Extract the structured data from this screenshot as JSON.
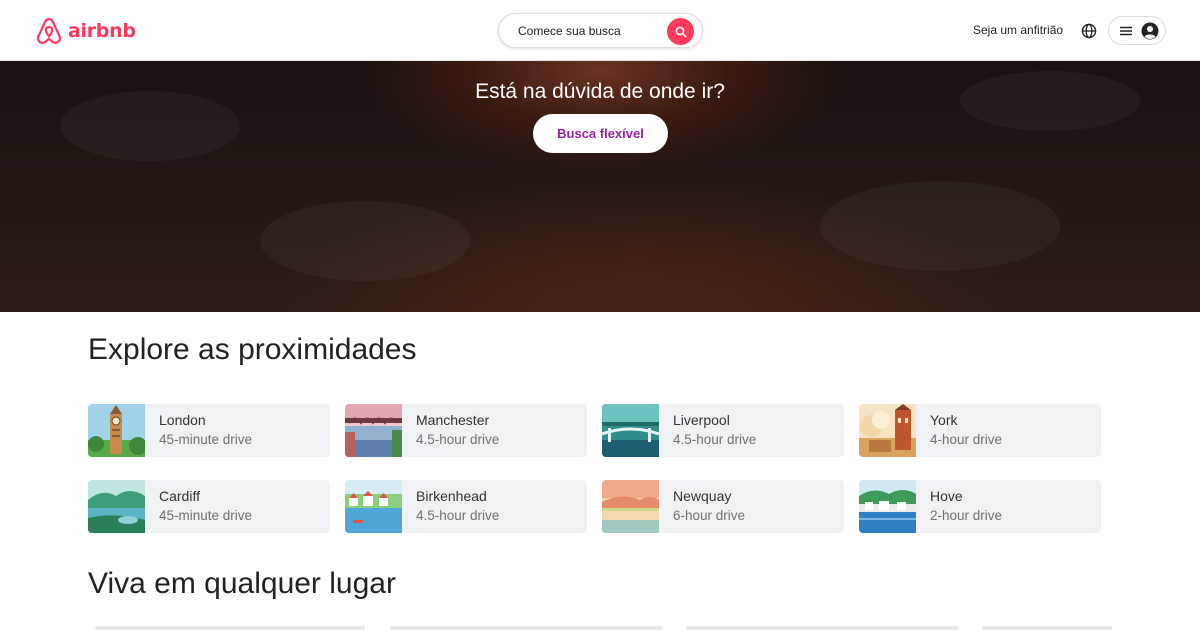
{
  "header": {
    "logo_text": "airbnb",
    "search_placeholder": "Comece sua busca",
    "host_link": "Seja um anfitrião",
    "icons": [
      "airbnb-logo-icon",
      "search-icon",
      "globe-icon",
      "menu-icon",
      "user-avatar-icon"
    ]
  },
  "hero": {
    "title": "Está na dúvida de onde ir?",
    "button": "Busca flexível"
  },
  "explore": {
    "title": "Explore as proximidades",
    "destinations": [
      {
        "city": "London",
        "drive": "45-minute drive"
      },
      {
        "city": "Manchester",
        "drive": "4.5-hour drive"
      },
      {
        "city": "Liverpool",
        "drive": "4.5-hour drive"
      },
      {
        "city": "York",
        "drive": "4-hour drive"
      },
      {
        "city": "Cardiff",
        "drive": "45-minute drive"
      },
      {
        "city": "Birkenhead",
        "drive": "4.5-hour drive"
      },
      {
        "city": "Newquay",
        "drive": "6-hour drive"
      },
      {
        "city": "Hove",
        "drive": "2-hour drive"
      }
    ]
  },
  "live": {
    "title": "Viva em qualquer lugar"
  },
  "colors": {
    "brand": "#FF385C",
    "flex_button_text": "#9A1FA8",
    "card_bg": "#f0f2f6",
    "secondary_text": "#717171"
  }
}
